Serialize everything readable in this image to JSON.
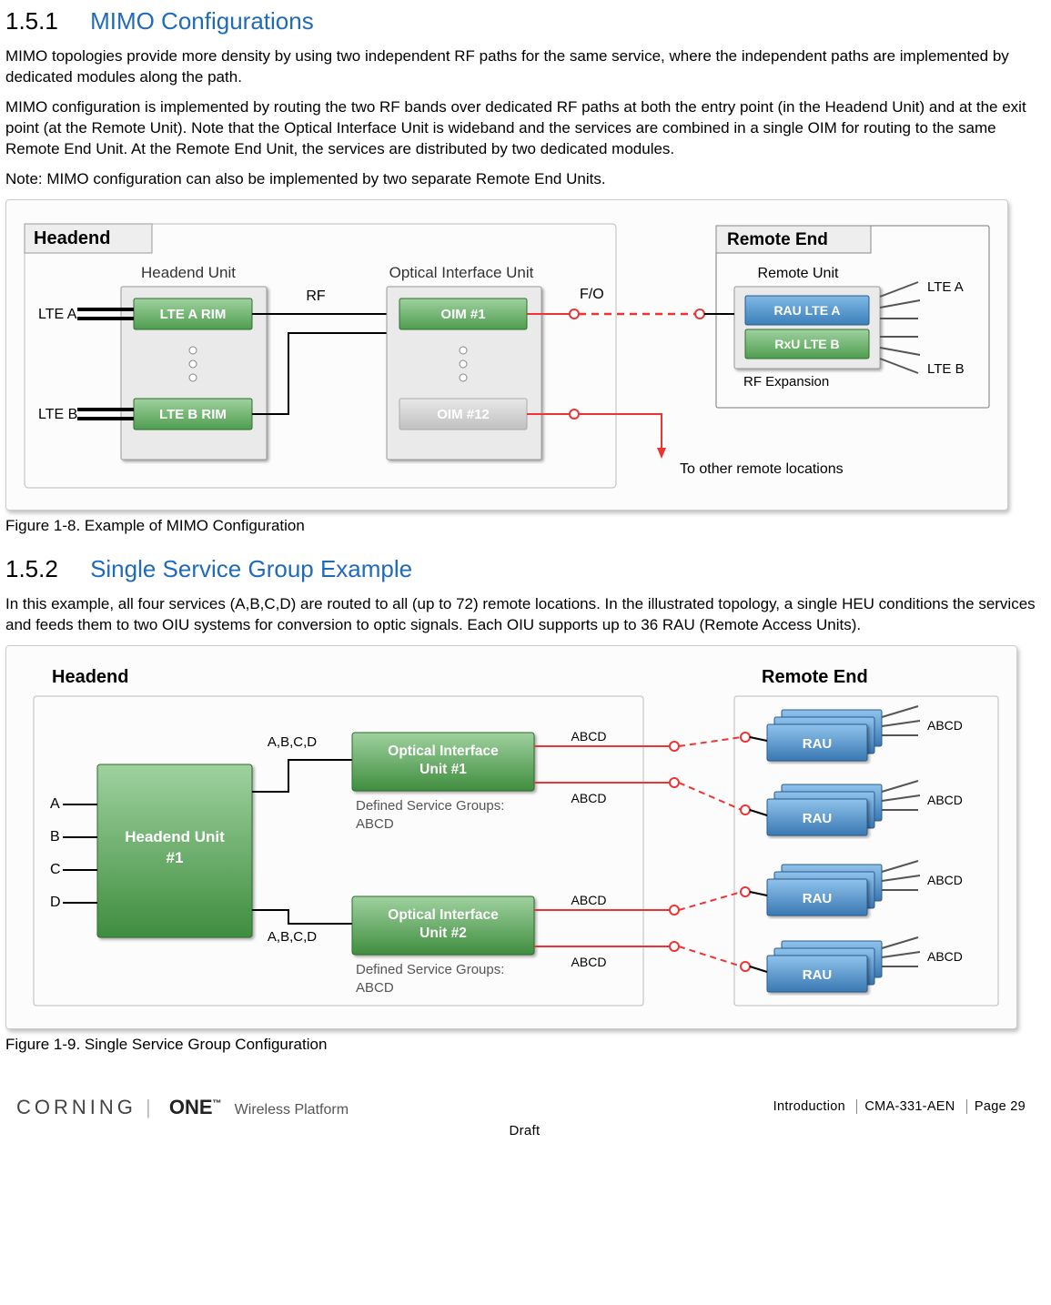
{
  "s151": {
    "num": "1.5.1",
    "title": "MIMO Configurations",
    "p1": "MIMO topologies provide more density by using two independent RF paths for the same service, where the independent paths are implemented by dedicated modules along the path.",
    "p2": "MIMO configuration is implemented by routing the two RF bands over dedicated RF paths at both the entry point (in the Headend Unit) and at the exit point (at the Remote Unit). Note that the Optical Interface Unit is wideband and the services are combined in a single OIM for routing to the same Remote End Unit. At the Remote End Unit, the services are distributed by two dedicated modules.",
    "p3": "Note: MIMO configuration can also be implemented by two separate Remote End Units."
  },
  "fig1": {
    "caption": "Figure 1-8. Example of MIMO Configuration",
    "headend": "Headend",
    "remoteEnd": "Remote End",
    "headendUnit": "Headend Unit",
    "oiu": "Optical Interface Unit",
    "rf": "RF",
    "fo": "F/O",
    "lteA": "LTE A",
    "lteB": "LTE B",
    "lteARim": "LTE A RIM",
    "lteBRim": "LTE B RIM",
    "oim1": "OIM #1",
    "oim12": "OIM #12",
    "remoteUnit": "Remote Unit",
    "rauLteA": "RAU LTE A",
    "rxuLteB": "RxU LTE B",
    "rfExp": "RF Expansion",
    "lteAOut": "LTE A",
    "lteBOut": "LTE B",
    "other": "To other remote locations"
  },
  "s152": {
    "num": "1.5.2",
    "title": "Single Service Group Example",
    "p1": "In this example, all four services (A,B,C,D) are routed to all (up to 72) remote locations. In the illustrated topology, a single HEU conditions the services and feeds them to two OIU systems for conversion to optic signals. Each OIU supports up to 36 RAU (Remote Access Units)."
  },
  "fig2": {
    "caption": "Figure 1-9. Single Service Group Configuration",
    "headend": "Headend",
    "remoteEnd": "Remote End",
    "abcdList": "A,B,C,D",
    "abcd": "ABCD",
    "a": "A",
    "b": "B",
    "c": "C",
    "d": "D",
    "heu": "Headend Unit #1",
    "oiu1a": "Optical Interface",
    "oiu1b": "Unit #1",
    "oiu2a": "Optical Interface",
    "oiu2b": "Unit #2",
    "dsg": "Defined Service Groups:",
    "dsgv": "ABCD",
    "rau": "RAU"
  },
  "footer": {
    "intro": "Introduction",
    "doc": "CMA-331-AEN",
    "page": "Page 29",
    "draft": "Draft",
    "brand1": "CORNING",
    "brand2": "ONE",
    "brand3": "Wireless Platform"
  }
}
